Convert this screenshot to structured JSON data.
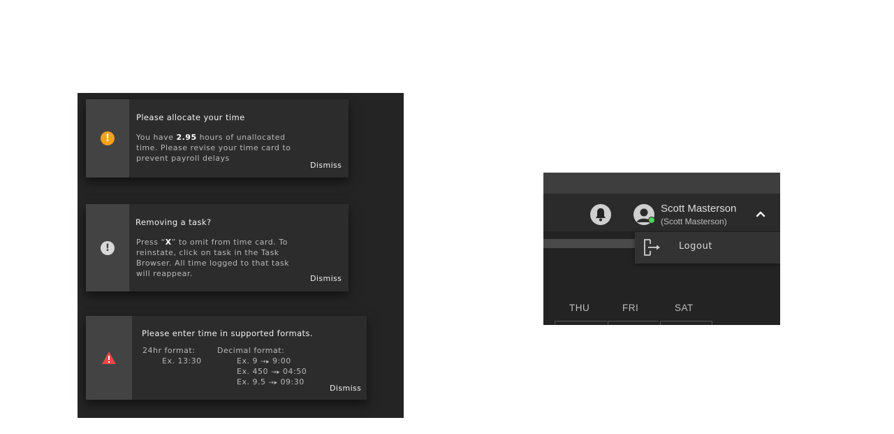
{
  "notifications": [
    {
      "icon": "warning-circle-icon",
      "icon_color": "#f4a11a",
      "title": "Please allocate your time",
      "body_pre": "You have ",
      "body_bold": "2.95",
      "body_post": " hours of unallocated time. Please revise your time card to prevent payroll delays",
      "dismiss_label": "Dismiss"
    },
    {
      "icon": "info-exclamation-icon",
      "icon_color": "#d8d8d8",
      "title": "Removing a task?",
      "body_pre": "Press “",
      "body_bold": "X",
      "body_post": "” to omit from time card. To reinstate, click on task in the Task Browser. All time logged to that task will reappear.",
      "dismiss_label": "Dismiss"
    },
    {
      "icon": "alert-triangle-icon",
      "icon_color": "#e8474b",
      "title": "Please enter time in supported formats.",
      "format_24_label": "24hr format:",
      "format_24_example": "Ex. 13:30",
      "decimal_label": "Decimal format:",
      "decimal_examples": [
        {
          "input": "Ex. 9",
          "output": "9:00"
        },
        {
          "input": "Ex. 450",
          "output": "04:50"
        },
        {
          "input": "Ex. 9.5",
          "output": "09:30"
        }
      ],
      "dismiss_label": "Dismiss"
    }
  ],
  "header": {
    "user_name": "Scott Masterson",
    "user_sub": "(Scott Masterson)",
    "status": "online",
    "status_color": "#4cd25a"
  },
  "user_menu": {
    "items": [
      {
        "icon": "logout-icon",
        "label": "Logout"
      }
    ]
  },
  "calendar": {
    "days": [
      "THU",
      "FRI",
      "SAT"
    ]
  }
}
